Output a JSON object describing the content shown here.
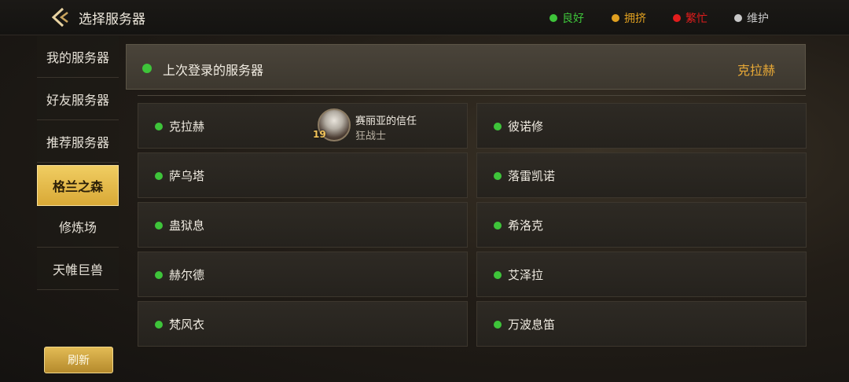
{
  "header": {
    "title": "选择服务器"
  },
  "legend": [
    {
      "label": "良好",
      "color": "#3ec43a"
    },
    {
      "label": "拥挤",
      "color": "#e0a020"
    },
    {
      "label": "繁忙",
      "color": "#e21d1d"
    },
    {
      "label": "维护",
      "color": "#c8c8c8"
    }
  ],
  "sidebar": {
    "items": [
      {
        "label": "我的服务器",
        "active": false
      },
      {
        "label": "好友服务器",
        "active": false
      },
      {
        "label": "推荐服务器",
        "active": false
      },
      {
        "label": "格兰之森",
        "active": true
      },
      {
        "label": "修炼场",
        "active": false
      },
      {
        "label": "天帷巨兽",
        "active": false
      }
    ],
    "refresh_label": "刷新"
  },
  "last_login": {
    "label": "上次登录的服务器",
    "server": "克拉赫",
    "status_color": "#3ec43a"
  },
  "servers": [
    {
      "name": "克拉赫",
      "status_color": "#3ec43a",
      "character": {
        "name": "赛丽亚的信任",
        "class": "狂战士",
        "level": "19"
      }
    },
    {
      "name": "彼诺修",
      "status_color": "#3ec43a"
    },
    {
      "name": "萨乌塔",
      "status_color": "#3ec43a"
    },
    {
      "name": "落雷凯诺",
      "status_color": "#3ec43a"
    },
    {
      "name": "蛊狱息",
      "status_color": "#3ec43a"
    },
    {
      "name": "希洛克",
      "status_color": "#3ec43a"
    },
    {
      "name": "赫尔德",
      "status_color": "#3ec43a"
    },
    {
      "name": "艾泽拉",
      "status_color": "#3ec43a"
    },
    {
      "name": "梵风衣",
      "status_color": "#3ec43a"
    },
    {
      "name": "万波息笛",
      "status_color": "#3ec43a"
    }
  ]
}
